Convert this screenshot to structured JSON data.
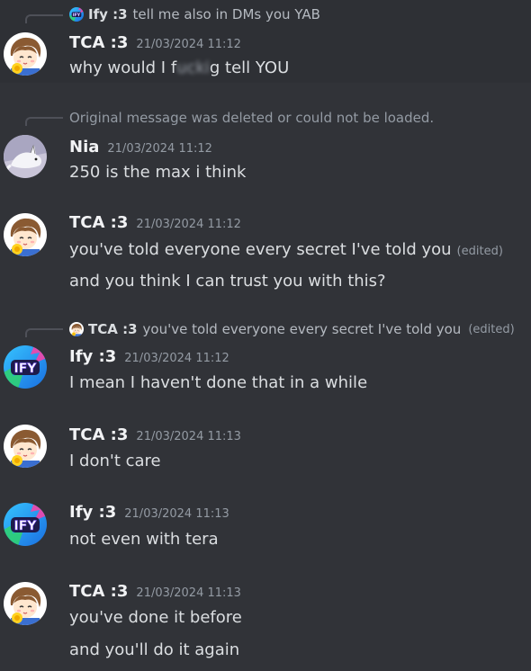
{
  "colors": {
    "background": "#313338",
    "text": "#dbdee1",
    "username": "#f2f3f5",
    "muted": "#949ba4"
  },
  "messages": [
    {
      "reply": {
        "user": "Ify :3",
        "text": "tell me also in DMs you YAB",
        "avatar": "ify-avatar-icon"
      },
      "user": "TCA :3",
      "time": "21/03/2024 11:12",
      "avatar": "tca-avatar-icon",
      "text_before": "why would I f",
      "text_censored": "ucki",
      "text_after": "g tell YOU"
    },
    {
      "reply_deleted": "Original message was deleted or could not be loaded.",
      "user": "Nia",
      "time": "21/03/2024 11:12",
      "avatar": "nia-cat-avatar-icon",
      "text": "250 is the max i think"
    },
    {
      "user": "TCA :3",
      "time": "21/03/2024 11:12",
      "avatar": "tca-avatar-icon",
      "text": "you've told everyone every secret I've told you",
      "edited": "(edited)",
      "text2": "and you think I can trust you with this?"
    },
    {
      "reply": {
        "user": "TCA :3",
        "text": "you've told everyone every secret I've told you",
        "edited": "(edited)",
        "avatar": "tca-avatar-icon"
      },
      "user": "Ify :3",
      "time": "21/03/2024 11:12",
      "avatar": "ify-avatar-icon",
      "text": "I mean I haven't done that in a while"
    },
    {
      "user": "TCA :3",
      "time": "21/03/2024 11:13",
      "avatar": "tca-avatar-icon",
      "text": "I don't care"
    },
    {
      "user": "Ify :3",
      "time": "21/03/2024 11:13",
      "avatar": "ify-avatar-icon",
      "text": "not even with tera"
    },
    {
      "user": "TCA :3",
      "time": "21/03/2024 11:13",
      "avatar": "tca-avatar-icon",
      "text": "you've done it before",
      "text2": "and you'll do it again"
    }
  ]
}
